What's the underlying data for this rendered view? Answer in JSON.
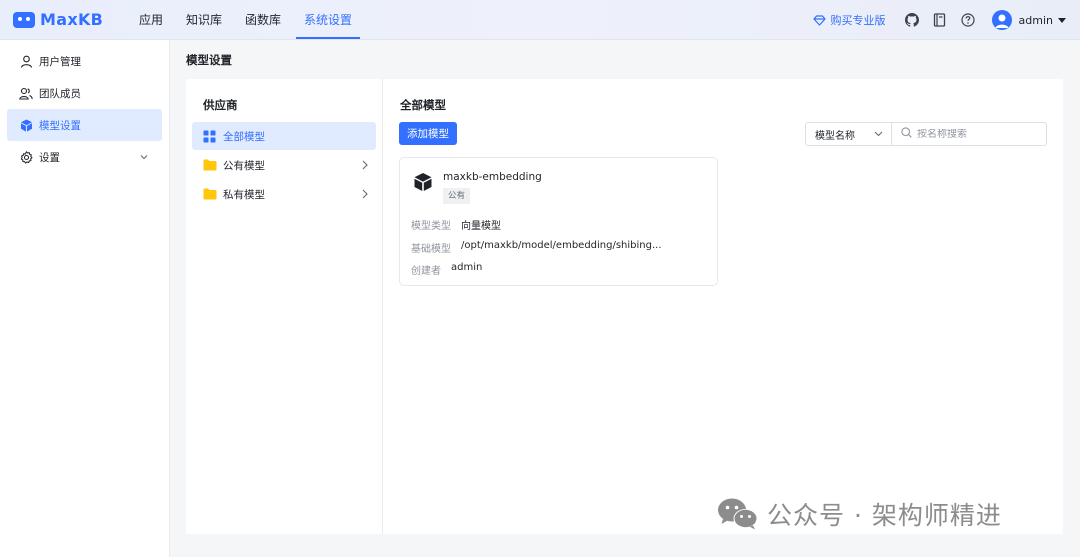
{
  "app": {
    "name": "MaxKB"
  },
  "nav": {
    "items": [
      {
        "label": "应用"
      },
      {
        "label": "知识库"
      },
      {
        "label": "函数库"
      },
      {
        "label": "系统设置"
      }
    ],
    "active": "系统设置"
  },
  "header": {
    "pro_label": "购买专业版",
    "username": "admin",
    "icons": [
      "diamond-icon",
      "github-icon",
      "book-icon",
      "help-icon",
      "avatar",
      "caret-down-icon"
    ]
  },
  "sidebar": {
    "items": [
      {
        "label": "用户管理",
        "icon": "user-icon"
      },
      {
        "label": "团队成员",
        "icon": "team-icon"
      },
      {
        "label": "模型设置",
        "icon": "cube-icon"
      },
      {
        "label": "设置",
        "icon": "gear-icon"
      }
    ],
    "active": "模型设置"
  },
  "page": {
    "title": "模型设置"
  },
  "providers": {
    "title": "供应商",
    "items": [
      {
        "label": "全部模型",
        "icon": "grid-icon"
      },
      {
        "label": "公有模型",
        "icon": "folder-icon"
      },
      {
        "label": "私有模型",
        "icon": "folder-icon"
      }
    ],
    "active": "全部模型"
  },
  "content": {
    "title": "全部模型",
    "add_button": "添加模型",
    "search": {
      "filter_value": "模型名称",
      "placeholder": "按名称搜索"
    }
  },
  "models": [
    {
      "name": "maxkb-embedding",
      "tag": "公有",
      "type_label": "模型类型",
      "type_value": "向量模型",
      "base_label": "基础模型",
      "base_value": "/opt/maxkb/model/embedding/shibing...",
      "creator_label": "创建者",
      "creator_value": "admin"
    }
  ],
  "watermark": {
    "text": "公众号 · 架构师精进"
  },
  "colors": {
    "primary": "#3370ff",
    "folder": "#ffc60a",
    "active_bg": "#e1ebff"
  }
}
